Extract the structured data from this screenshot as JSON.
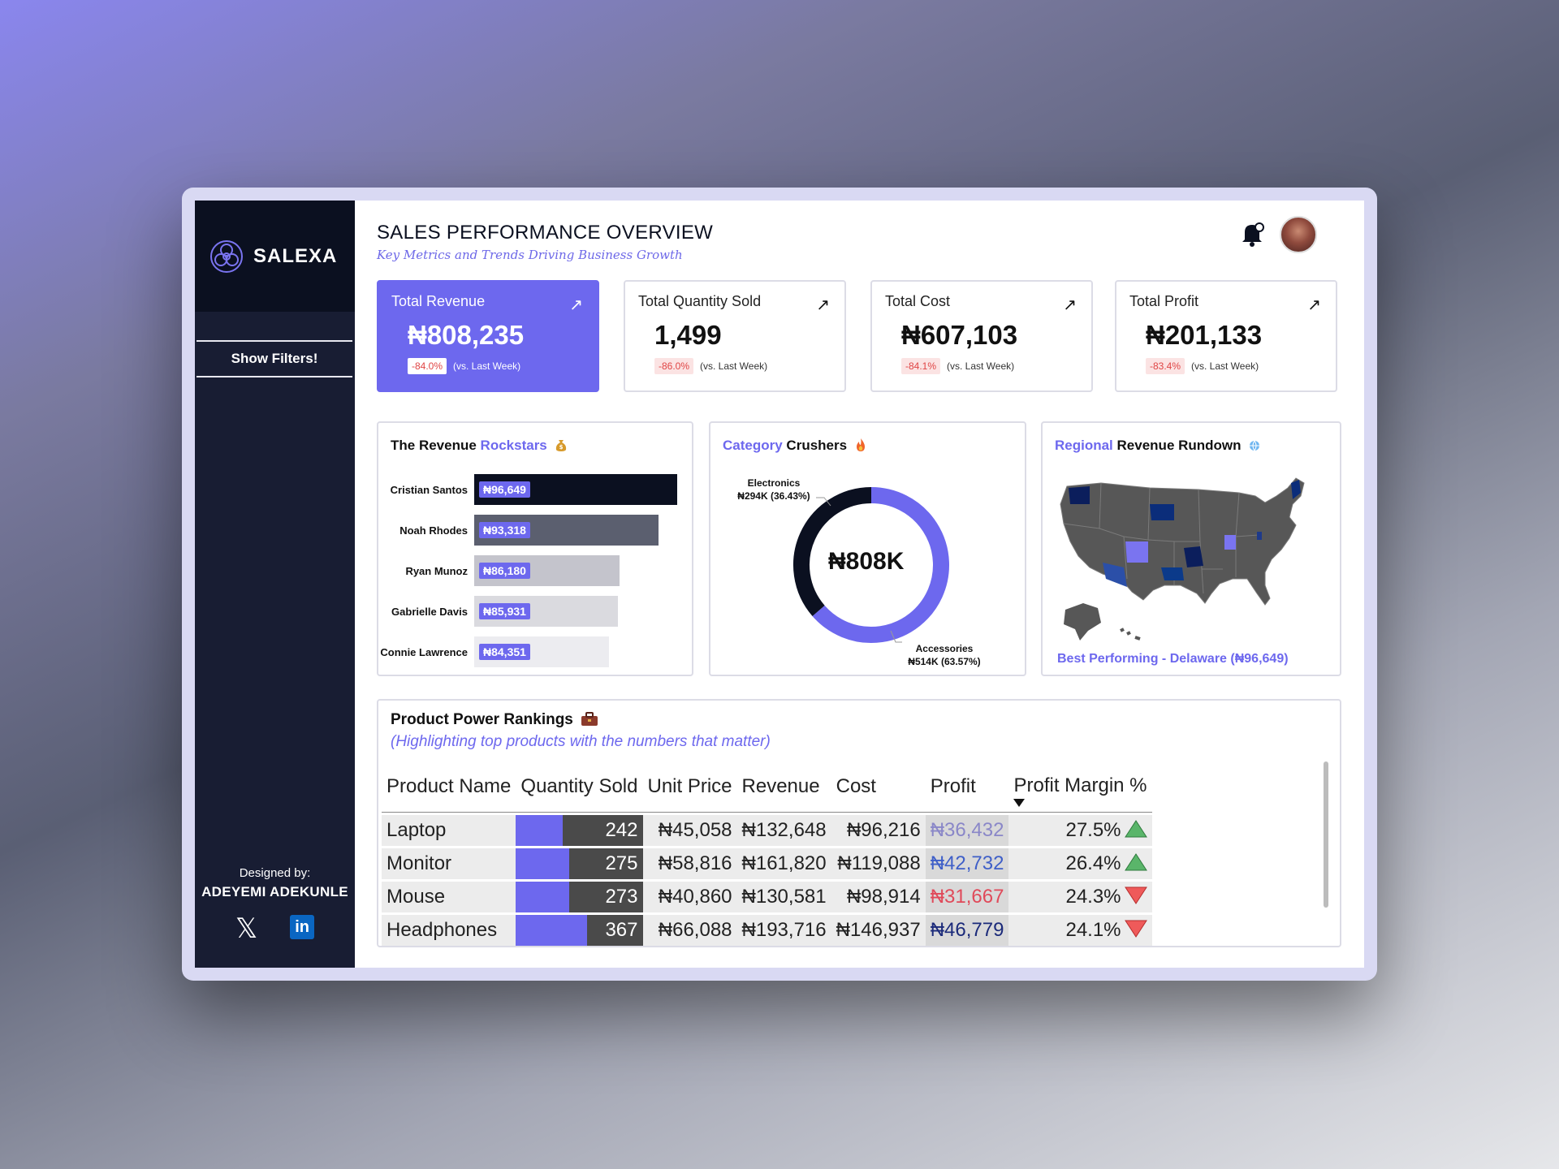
{
  "brand": {
    "name": "SALEXA"
  },
  "sidebar": {
    "show_filters": "Show Filters!",
    "designed_by_label": "Designed by:",
    "designer": "ADEYEMI ADEKUNLE"
  },
  "header": {
    "title": "SALES PERFORMANCE OVERVIEW",
    "subtitle": "Key Metrics and Trends Driving Business Growth"
  },
  "kpis": [
    {
      "label": "Total Revenue",
      "value": "₦808,235",
      "change": "-84.0%",
      "vs": "(vs. Last Week)"
    },
    {
      "label": "Total Quantity Sold",
      "value": "1,499",
      "change": "-86.0%",
      "vs": "(vs. Last Week)"
    },
    {
      "label": "Total Cost",
      "value": "₦607,103",
      "change": "-84.1%",
      "vs": "(vs. Last Week)"
    },
    {
      "label": "Total Profit",
      "value": "₦201,133",
      "change": "-83.4%",
      "vs": "(vs. Last Week)"
    }
  ],
  "rockstars": {
    "title_a": "The Revenue",
    "title_b": "Rockstars"
  },
  "crushers": {
    "title_a": "Category",
    "title_b": "Crushers",
    "center": "₦808K",
    "label_electronics": "Electronics",
    "value_electronics": "₦294K (36.43%)",
    "label_accessories": "Accessories",
    "value_accessories": "₦514K (63.57%)"
  },
  "regional": {
    "title_a": "Regional",
    "title_b": "Revenue Rundown",
    "best": "Best Performing - Delaware (₦96,649)"
  },
  "rankings": {
    "title": "Product Power Rankings",
    "subtitle": "(Highlighting top products with the numbers that matter)",
    "columns": [
      "Product Name",
      "Quantity Sold",
      "Unit Price",
      "Revenue",
      "Cost",
      "Profit",
      "Profit Margin %"
    ],
    "rows": [
      {
        "name": "Laptop",
        "qty": "242",
        "qty_share": 0.66,
        "unit": "₦45,058",
        "revenue": "₦132,648",
        "cost": "₦96,216",
        "profit": "₦36,432",
        "profit_color": "#8a87c8",
        "margin": "27.5%",
        "trend": "up"
      },
      {
        "name": "Monitor",
        "qty": "275",
        "qty_share": 0.75,
        "unit": "₦58,816",
        "revenue": "₦161,820",
        "cost": "₦119,088",
        "profit": "₦42,732",
        "profit_color": "#3f5fc8",
        "margin": "26.4%",
        "trend": "up"
      },
      {
        "name": "Mouse",
        "qty": "273",
        "qty_share": 0.74,
        "unit": "₦40,860",
        "revenue": "₦130,581",
        "cost": "₦98,914",
        "profit": "₦31,667",
        "profit_color": "#e04a5a",
        "margin": "24.3%",
        "trend": "down"
      },
      {
        "name": "Headphones",
        "qty": "367",
        "qty_share": 1.0,
        "unit": "₦66,088",
        "revenue": "₦193,716",
        "cost": "₦146,937",
        "profit": "₦46,779",
        "profit_color": "#1b2a7a",
        "margin": "24.1%",
        "trend": "down"
      }
    ]
  },
  "chart_data": [
    {
      "type": "bar",
      "orientation": "horizontal",
      "categories": [
        "Cristian Santos",
        "Noah Rhodes",
        "Ryan Munoz",
        "Gabrielle Davis",
        "Connie Lawrence"
      ],
      "values": [
        96649,
        93318,
        86180,
        85931,
        84351
      ],
      "labels": [
        "₦96,649",
        "₦93,318",
        "₦86,180",
        "₦85,931",
        "₦84,351"
      ],
      "colors": [
        "#0b1020",
        "#5b5f6f",
        "#c4c4cc",
        "#dadadf",
        "#ececf0"
      ]
    },
    {
      "type": "pie",
      "style": "donut",
      "categories": [
        "Electronics",
        "Accessories"
      ],
      "values": [
        294,
        514
      ],
      "percentages": [
        36.43,
        63.57
      ],
      "colors": [
        "#0b1020",
        "#6d68ee"
      ]
    }
  ],
  "colors": {
    "accent": "#6d68ee",
    "sidebar": "#181d33",
    "brand_bg": "#0b1020",
    "negative": "#e04545"
  },
  "icons": {
    "bell": "bell-icon",
    "x": "x-logo-icon",
    "linkedin": "linkedin-icon",
    "arrow": "arrow-up-right-icon"
  }
}
